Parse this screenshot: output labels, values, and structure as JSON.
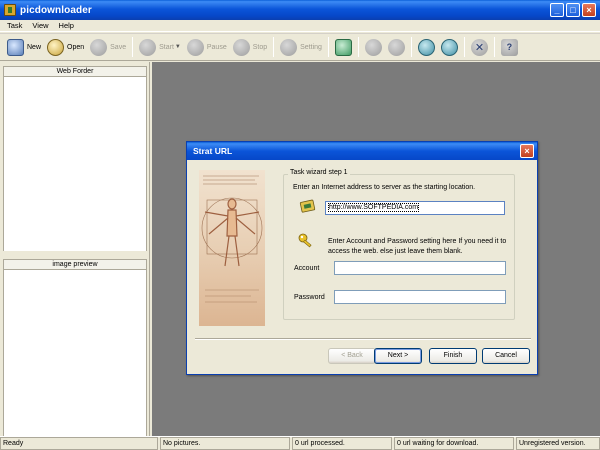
{
  "window": {
    "title": "picdownloader",
    "controls": {
      "minimize": "_",
      "maximize": "□",
      "close": "×"
    }
  },
  "menu": [
    "Task",
    "View",
    "Help"
  ],
  "toolbar": {
    "new": {
      "label": "New",
      "icon": "new-task-icon"
    },
    "open": {
      "label": "Open",
      "icon": "open-folder-icon"
    },
    "save": {
      "label": "Save",
      "icon": "save-icon"
    },
    "start": {
      "label": "Start",
      "icon": "start-icon"
    },
    "pause": {
      "label": "Pause",
      "icon": "pause-icon"
    },
    "stop": {
      "label": "Stop",
      "icon": "stop-icon"
    },
    "setting": {
      "label": "Setting",
      "icon": "setting-icon"
    },
    "extra_icons": [
      "search-icon",
      "options-icon",
      "options2-icon",
      "minus-icon",
      "remove-icon",
      "close-x-icon",
      "help-icon"
    ]
  },
  "left_panel": {
    "folder_header": "Web Forder",
    "preview_header": "image preview"
  },
  "dialog": {
    "title": "Strat URL",
    "close": "×",
    "group_title": "Task wizard step 1",
    "instruction": "Enter an Internet address to server as the starting location.",
    "url_value": "http://www.SOFTPEDIA.com",
    "account_note_line1": "Enter Account and Password setting here If you need it to",
    "account_note_line2": "access the web.  else just leave them blank.",
    "account_label": "Account",
    "account_value": "",
    "password_label": "Password",
    "password_value": "",
    "buttons": {
      "back": "< Back",
      "next": "Next >",
      "finish": "Finish",
      "cancel": "Cancel"
    }
  },
  "status": {
    "ready": "Ready",
    "pictures": "No pictures.",
    "processed": "0 url processed.",
    "waiting": "0 url waiting for download.",
    "registration": "Unregistered version."
  }
}
